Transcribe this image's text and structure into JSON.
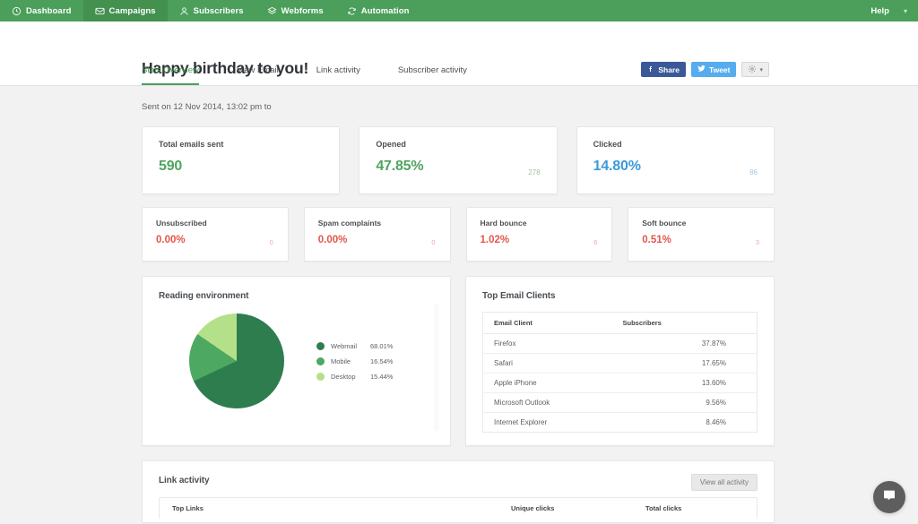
{
  "nav": {
    "items": [
      {
        "label": "Dashboard",
        "icon": "clock-icon",
        "active": false
      },
      {
        "label": "Campaigns",
        "icon": "envelope-icon",
        "active": true
      },
      {
        "label": "Subscribers",
        "icon": "person-icon",
        "active": false
      },
      {
        "label": "Webforms",
        "icon": "layers-icon",
        "active": false
      },
      {
        "label": "Automation",
        "icon": "refresh-icon",
        "active": false
      }
    ],
    "help_label": "Help",
    "caret": "▾"
  },
  "header": {
    "title": "Happy birthday to you!",
    "share_label": "Share",
    "tweet_label": "Tweet",
    "gear_caret": "▾",
    "tabs": [
      {
        "label": "Stats Overview",
        "active": true
      },
      {
        "label": "View Email",
        "active": false
      },
      {
        "label": "Link activity",
        "active": false
      },
      {
        "label": "Subscriber activity",
        "active": false
      }
    ]
  },
  "sent_line": "Sent on 12 Nov 2014, 13:02 pm to",
  "stats_primary": [
    {
      "label": "Total emails sent",
      "value": "590",
      "count": "",
      "color": "green"
    },
    {
      "label": "Opened",
      "value": "47.85%",
      "count": "278",
      "color": "green"
    },
    {
      "label": "Clicked",
      "value": "14.80%",
      "count": "86",
      "color": "blue"
    }
  ],
  "stats_secondary": [
    {
      "label": "Unsubscribed",
      "value": "0.00%",
      "count": "0"
    },
    {
      "label": "Spam complaints",
      "value": "0.00%",
      "count": "0"
    },
    {
      "label": "Hard bounce",
      "value": "1.02%",
      "count": "6"
    },
    {
      "label": "Soft bounce",
      "value": "0.51%",
      "count": "3"
    }
  ],
  "reading_environment": {
    "title": "Reading environment"
  },
  "email_clients": {
    "title": "Top Email Clients",
    "columns": [
      "Email Client",
      "Subscribers"
    ],
    "rows": [
      {
        "client": "Firefox",
        "subscribers": "37.87%"
      },
      {
        "client": "Safari",
        "subscribers": "17.65%"
      },
      {
        "client": "Apple iPhone",
        "subscribers": "13.60%"
      },
      {
        "client": "Microsoft Outlook",
        "subscribers": "9.56%"
      },
      {
        "client": "Internet Explorer",
        "subscribers": "8.46%"
      }
    ]
  },
  "link_activity": {
    "title": "Link activity",
    "view_all_label": "View all activity",
    "columns": [
      "Top Links",
      "Unique clicks",
      "Total clicks"
    ]
  },
  "colors": {
    "brand_green": "#4b9f5a",
    "brand_green_active": "#43904f",
    "stat_green": "#51a35f",
    "stat_blue": "#3b9adb",
    "stat_red": "#e2574c",
    "pie_webmail": "#2e7d4f",
    "pie_mobile": "#4da862",
    "pie_desktop": "#b5e08a",
    "facebook": "#3b5998",
    "twitter": "#55acee"
  },
  "chart_data": {
    "type": "pie",
    "title": "Reading environment",
    "categories": [
      "Webmail",
      "Mobile",
      "Desktop"
    ],
    "values": [
      68.01,
      16.54,
      15.44
    ],
    "labels": [
      "68.01%",
      "16.54%",
      "15.44%"
    ],
    "colors": [
      "#2e7d4f",
      "#4da862",
      "#b5e08a"
    ],
    "legend_position": "right",
    "grid": false
  }
}
